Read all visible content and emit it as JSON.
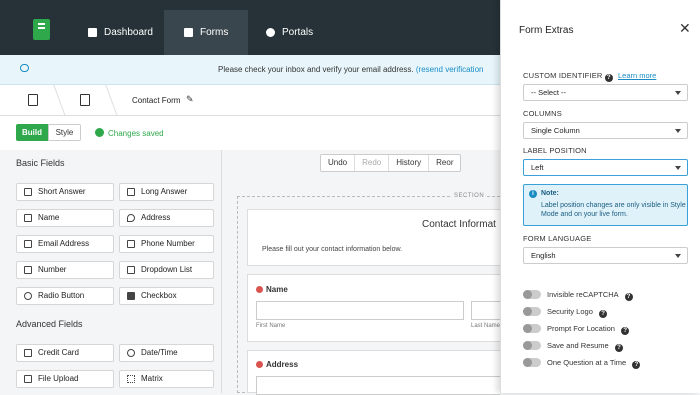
{
  "topnav": {
    "items": [
      {
        "label": "Dashboard",
        "icon": "dashboard-icon"
      },
      {
        "label": "Forms",
        "icon": "forms-icon",
        "active": true
      },
      {
        "label": "Portals",
        "icon": "portals-icon"
      }
    ]
  },
  "notice": {
    "text": "Please check your inbox and verify your email address. ",
    "link": "(resend verification"
  },
  "breadcrumb": {
    "title": "Contact Form"
  },
  "toolbar": {
    "build_label": "Build",
    "style_label": "Style",
    "saved_label": "Changes saved"
  },
  "left": {
    "basic_title": "Basic Fields",
    "basic_fields": [
      "Short Answer",
      "Long Answer",
      "Name",
      "Address",
      "Email Address",
      "Phone Number",
      "Number",
      "Dropdown List",
      "Radio Button",
      "Checkbox"
    ],
    "advanced_title": "Advanced Fields",
    "advanced_fields": [
      "Credit Card",
      "Date/Time",
      "File Upload",
      "Matrix"
    ]
  },
  "history": {
    "undo": "Undo",
    "redo": "Redo",
    "history": "History",
    "reorder": "Reor"
  },
  "form": {
    "section_label": "SECTION",
    "title": "Contact Informat",
    "subtitle": "Please fill out your contact information below.",
    "name_label": "Name",
    "first_name_hint": "First Name",
    "last_name_hint": "Last Name",
    "address_label": "Address"
  },
  "extras": {
    "title": "Form Extras",
    "custom_identifier_label": "CUSTOM IDENTIFIER",
    "learn_more": "Learn more",
    "custom_identifier_value": "-- Select --",
    "columns_label": "COLUMNS",
    "columns_value": "Single Column",
    "label_position_label": "LABEL POSITION",
    "label_position_value": "Left",
    "note_title": "Note:",
    "note_body": "Label position changes are only visible in Style Mode and on your live form.",
    "language_label": "FORM LANGUAGE",
    "language_value": "English",
    "toggles": [
      "Invisible reCAPTCHA",
      "Security Logo",
      "Prompt For Location",
      "Save and Resume",
      "One Question at a Time"
    ]
  },
  "colors": {
    "brand": "#2ea84b",
    "topbar": "#263238",
    "link": "#1a8cc4",
    "required": "#d9534f"
  }
}
